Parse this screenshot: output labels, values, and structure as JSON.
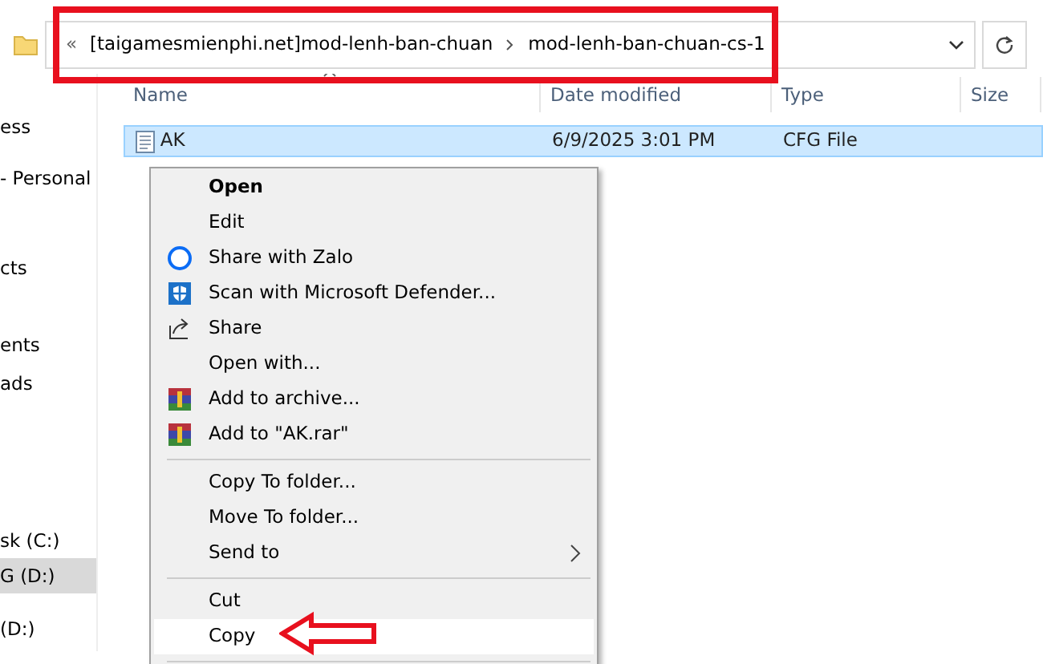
{
  "address_bar": {
    "overflow": "«",
    "crumbs": [
      "[taigamesmienphi.net]mod-lenh-ban-chuan",
      "mod-lenh-ban-chuan-cs-1"
    ]
  },
  "sidebar": {
    "items": [
      {
        "label": "ess",
        "selected": false
      },
      {
        "label": "- Personal",
        "selected": false
      },
      {
        "label": "cts",
        "selected": false
      },
      {
        "label": "ents",
        "selected": false
      },
      {
        "label": "ads",
        "selected": false
      },
      {
        "label": "sk (C:)",
        "selected": false
      },
      {
        "label": "G (D:)",
        "selected": true
      },
      {
        "label": "(D:)",
        "selected": false
      }
    ]
  },
  "table": {
    "columns": [
      "Name",
      "Date modified",
      "Type",
      "Size"
    ],
    "rows": [
      {
        "name": "AK",
        "date": "6/9/2025 3:01 PM",
        "type": "CFG File",
        "selected": true
      }
    ]
  },
  "context_menu": [
    {
      "kind": "plain",
      "label": "Open",
      "default": true,
      "submenu": false,
      "selected": false
    },
    {
      "kind": "plain",
      "label": "Edit",
      "default": false,
      "submenu": false,
      "selected": false
    },
    {
      "kind": "zalo",
      "label": "Share with Zalo",
      "default": false,
      "submenu": false,
      "selected": false
    },
    {
      "kind": "defender",
      "label": "Scan with Microsoft Defender...",
      "default": false,
      "submenu": false,
      "selected": false
    },
    {
      "kind": "share",
      "label": "Share",
      "default": false,
      "submenu": false,
      "selected": false
    },
    {
      "kind": "plain",
      "label": "Open with...",
      "default": false,
      "submenu": false,
      "selected": false
    },
    {
      "kind": "winrar",
      "label": "Add to archive...",
      "default": false,
      "submenu": false,
      "selected": false
    },
    {
      "kind": "winrar",
      "label": "Add to \"AK.rar\"",
      "default": false,
      "submenu": false,
      "selected": false
    },
    {
      "kind": "separator"
    },
    {
      "kind": "plain",
      "label": "Copy To folder...",
      "default": false,
      "submenu": false,
      "selected": false
    },
    {
      "kind": "plain",
      "label": "Move To folder...",
      "default": false,
      "submenu": false,
      "selected": false
    },
    {
      "kind": "plain",
      "label": "Send to",
      "default": false,
      "submenu": true,
      "selected": false
    },
    {
      "kind": "separator"
    },
    {
      "kind": "plain",
      "label": "Cut",
      "default": false,
      "submenu": false,
      "selected": false
    },
    {
      "kind": "plain",
      "label": "Copy",
      "default": false,
      "submenu": false,
      "selected": true
    },
    {
      "kind": "separator"
    }
  ]
}
